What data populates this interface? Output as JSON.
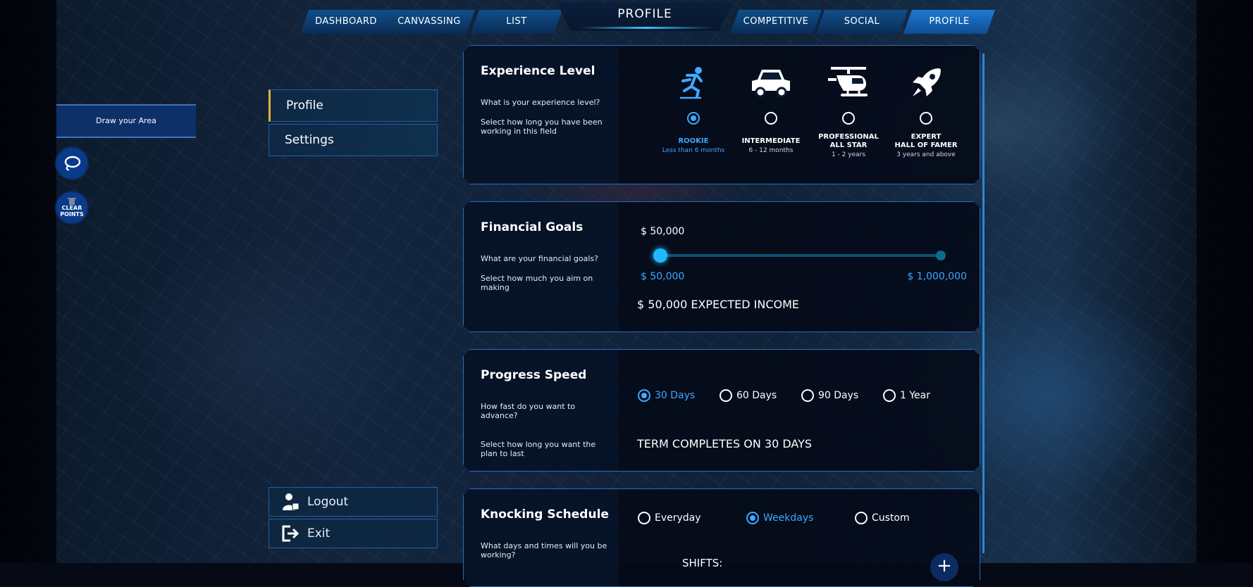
{
  "nav": {
    "left_tabs": [
      "DASHBOARD",
      "CANVASSING",
      "LIST"
    ],
    "center_title": "PROFILE",
    "right_tabs": [
      "COMPETITIVE",
      "SOCIAL",
      "PROFILE"
    ],
    "active_tab": "PROFILE"
  },
  "tools": {
    "draw_area": "Draw your Area",
    "clear_points_line1": "CLEAR",
    "clear_points_line2": "POINTS"
  },
  "menu": {
    "items": [
      {
        "label": "Profile",
        "active": true
      },
      {
        "label": "Settings",
        "active": false
      }
    ],
    "logout": "Logout",
    "exit": "Exit"
  },
  "experience": {
    "title": "Experience Level",
    "question": "What is your experience level?",
    "hint": "Select how long you have been working in this field",
    "levels": [
      {
        "icon": "skater-icon",
        "title": "ROOKIE",
        "subtitle": "Less than 6 months",
        "selected": true
      },
      {
        "icon": "car-icon",
        "title": "INTERMEDIATE",
        "subtitle": "6 - 12 months",
        "selected": false
      },
      {
        "icon": "helicopter-icon",
        "title_line1": "PROFESSIONAL",
        "title_line2": "ALL STAR",
        "subtitle": "1 - 2 years",
        "selected": false
      },
      {
        "icon": "rocket-icon",
        "title_line1": "EXPERT",
        "title_line2": "HALL OF FAMER",
        "subtitle": "3 years and above",
        "selected": false
      }
    ]
  },
  "financial": {
    "title": "Financial Goals",
    "question": "What are your financial goals?",
    "hint": "Select how much you aim on making",
    "current_value": "$ 50,000",
    "min_label": "$ 50,000",
    "max_label": "$ 1,000,000",
    "slider_fraction": 0.0,
    "expected_income": "$ 50,000 EXPECTED INCOME"
  },
  "progress": {
    "title": "Progress Speed",
    "question": "How fast do you want to advance?",
    "hint": "Select how long you want the plan to last",
    "options": [
      {
        "label": "30 Days",
        "selected": true
      },
      {
        "label": "60 Days",
        "selected": false
      },
      {
        "label": "90 Days",
        "selected": false
      },
      {
        "label": "1 Year",
        "selected": false
      }
    ],
    "term_text": "TERM COMPLETES ON 30 DAYS"
  },
  "knocking": {
    "title": "Knocking Schedule",
    "question": "What days and times will you be working?",
    "options": [
      {
        "label": "Everyday",
        "selected": false
      },
      {
        "label": "Weekdays",
        "selected": true
      },
      {
        "label": "Custom",
        "selected": false
      }
    ],
    "shifts_label": "SHIFTS:",
    "add_label": "+"
  },
  "colors": {
    "accent": "#3fa8ff",
    "active_marker": "#e5b33c",
    "panel_border": "#2b6bc0"
  }
}
